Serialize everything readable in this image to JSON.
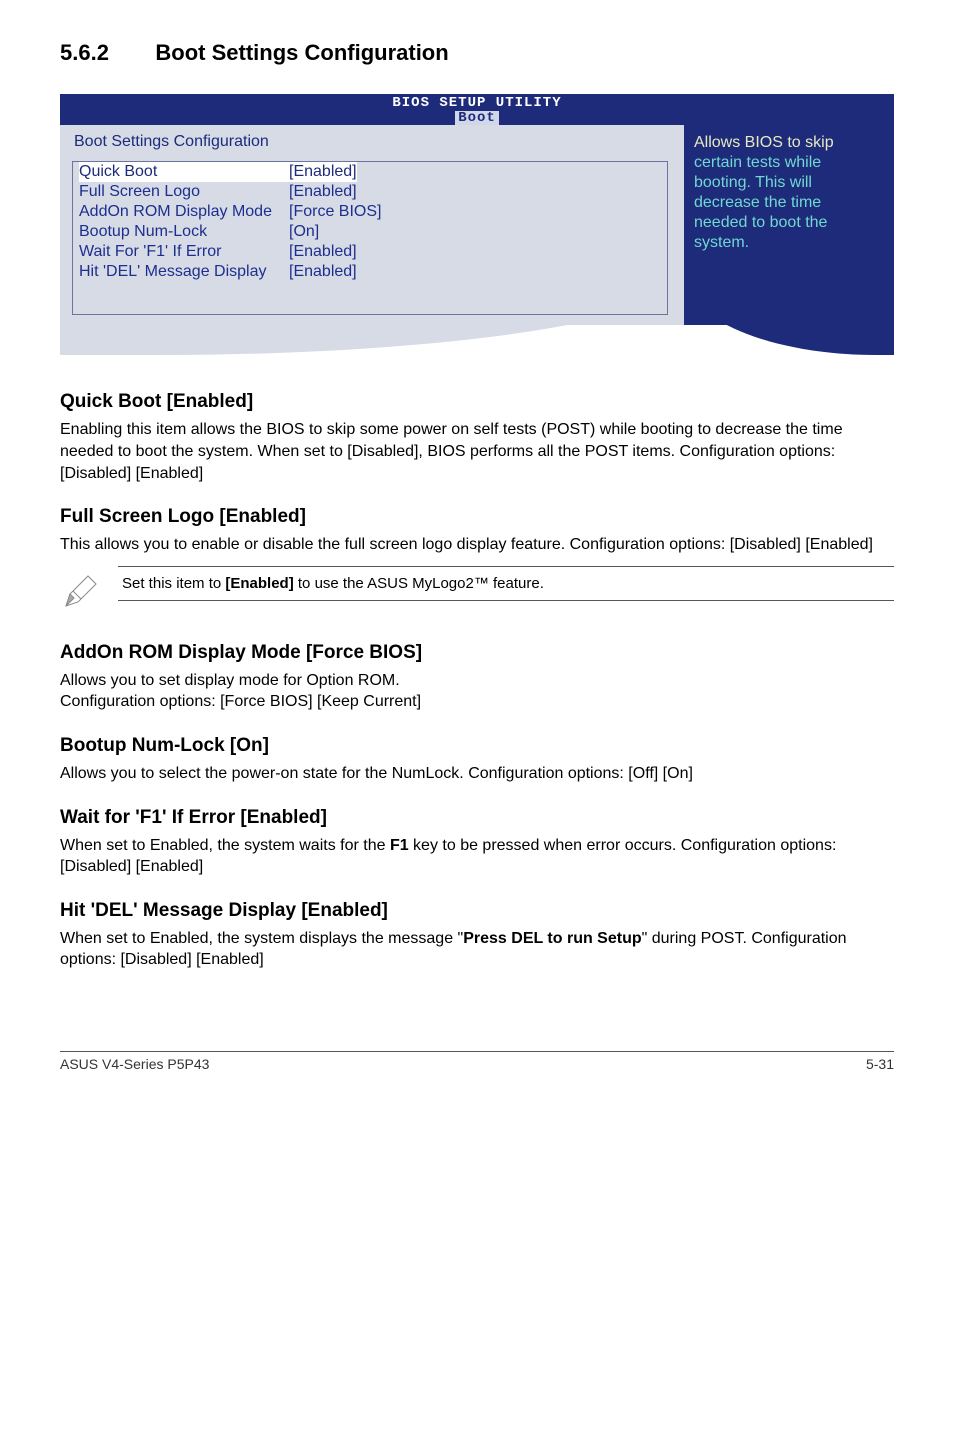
{
  "section": {
    "number": "5.6.2",
    "title": "Boot Settings Configuration"
  },
  "bios": {
    "header_line1": "BIOS SETUP UTILITY",
    "tab": "Boot",
    "panel_title": "Boot Settings Configuration",
    "rows": [
      {
        "label": "Quick Boot",
        "value": "[Enabled]",
        "selected": true
      },
      {
        "label": "Full Screen Logo",
        "value": "[Enabled]",
        "selected": false
      },
      {
        "label": "AddOn ROM Display Mode",
        "value": "[Force BIOS]",
        "selected": false
      },
      {
        "label": "Bootup Num-Lock",
        "value": "[On]",
        "selected": false
      },
      {
        "label": "Wait For 'F1' If Error",
        "value": "[Enabled]",
        "selected": false
      },
      {
        "label": "Hit 'DEL' Message Display",
        "value": "[Enabled]",
        "selected": false
      }
    ],
    "help": {
      "l0": "Allows BIOS to skip",
      "l1": "certain tests while",
      "l2": "booting. This will",
      "l3": "decrease the time",
      "l4": "needed to boot the",
      "l5": "system."
    }
  },
  "quickboot": {
    "heading": "Quick Boot [Enabled]",
    "body": "Enabling this item allows the BIOS to skip some power on self tests (POST) while booting to decrease the time needed to boot the system. When set to [Disabled], BIOS performs all the POST items. Configuration options: [Disabled] [Enabled]"
  },
  "fullscreen": {
    "heading": "Full Screen Logo [Enabled]",
    "body": "This allows you to enable or disable the full screen logo display feature. Configuration options: [Disabled] [Enabled]"
  },
  "note": {
    "prefix": "Set this item to ",
    "bold": "[Enabled]",
    "suffix": " to use the ASUS MyLogo2™ feature."
  },
  "addon": {
    "heading": "AddOn ROM Display Mode [Force BIOS]",
    "body": "Allows you to set display mode for Option ROM.\nConfiguration options: [Force BIOS] [Keep Current]"
  },
  "numlock": {
    "heading": "Bootup Num-Lock [On]",
    "body": "Allows you to select the power-on state for the NumLock. Configuration options: [Off] [On]"
  },
  "waitf1": {
    "heading": "Wait for 'F1' If Error [Enabled]",
    "prefix": "When set to Enabled, the system waits for the ",
    "bold": "F1",
    "suffix": " key to be pressed when error occurs. Configuration options: [Disabled] [Enabled]"
  },
  "hitdel": {
    "heading": "Hit 'DEL' Message Display [Enabled]",
    "prefix": "When set to Enabled, the system displays the message \"",
    "bold": "Press DEL to run Setup",
    "suffix": "\" during POST. Configuration options: [Disabled] [Enabled]"
  },
  "footer": {
    "left": "ASUS V4-Series P5P43",
    "right": "5-31"
  }
}
